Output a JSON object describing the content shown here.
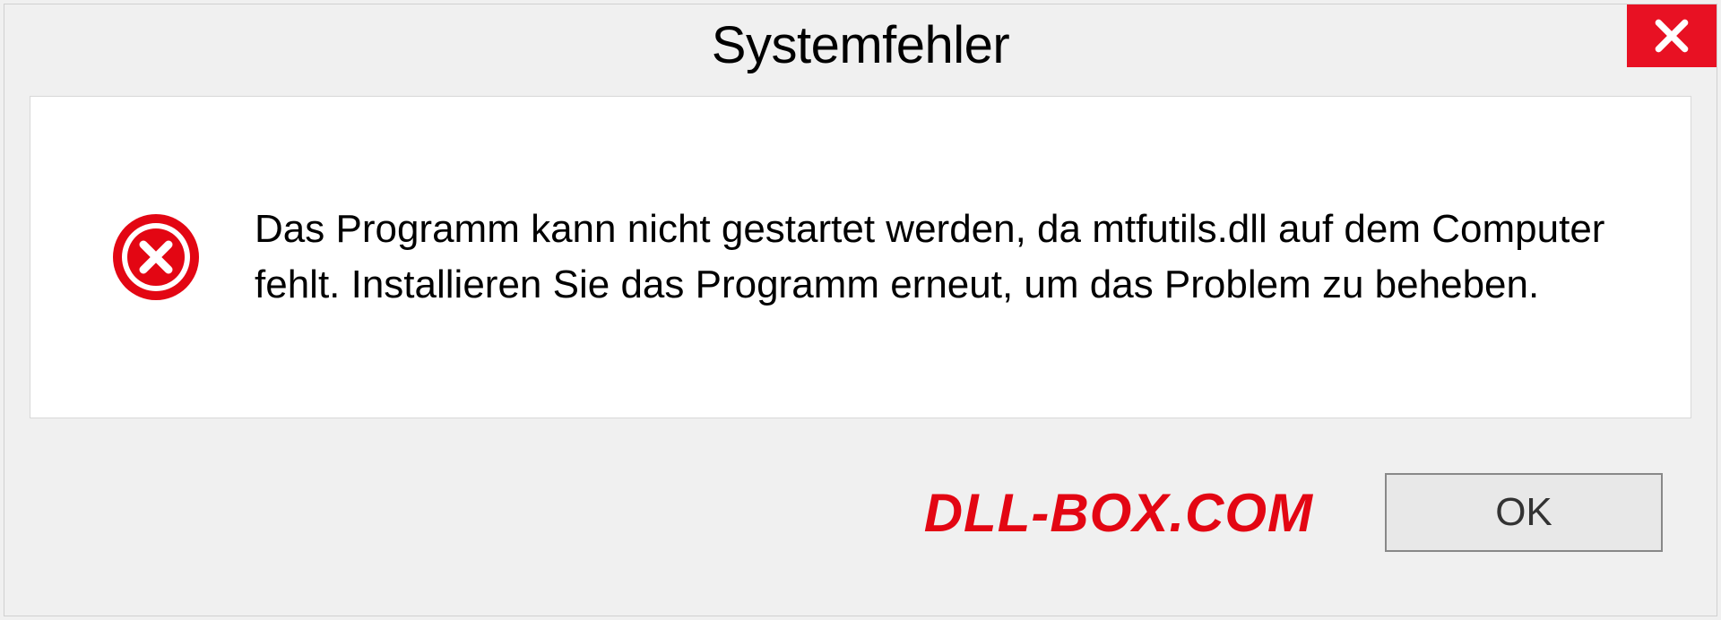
{
  "dialog": {
    "title": "Systemfehler",
    "message": "Das Programm kann nicht gestartet werden, da mtfutils.dll auf dem Computer fehlt. Installieren Sie das Programm erneut, um das Problem zu beheben.",
    "ok_label": "OK"
  },
  "watermark": "DLL-BOX.COM"
}
